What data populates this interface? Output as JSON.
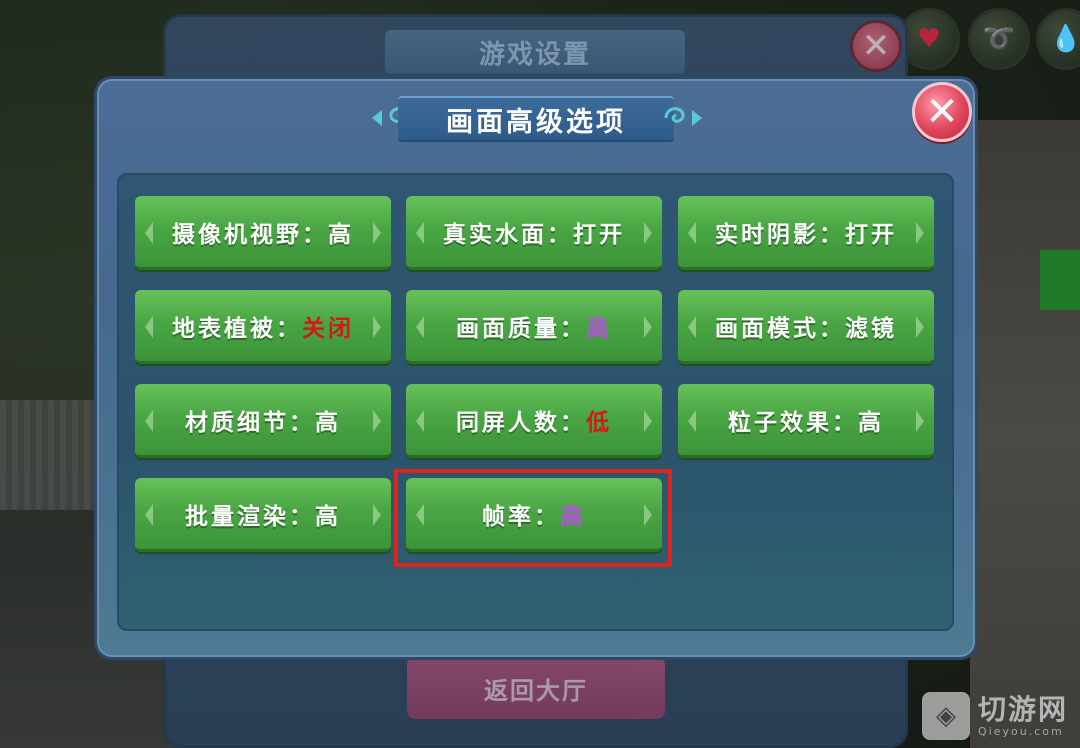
{
  "colors": {
    "accent_green": "#4aa644",
    "panel_blue": "#45688f",
    "value_red": "#d41818",
    "value_purple": "#b055d6",
    "highlight_red": "#e0231f",
    "close_pink": "#e0455c"
  },
  "background_dialog": {
    "title": "游戏设置",
    "return_button_label": "返回大厅"
  },
  "hud": {
    "icons": [
      "heart-icon",
      "arm-icon",
      "water-drop-icon"
    ]
  },
  "dialog": {
    "title": "画面高级选项",
    "options": [
      {
        "label": "摄像机视野：",
        "value": "高",
        "value_color": "white"
      },
      {
        "label": "真实水面：",
        "value": "打开",
        "value_color": "white"
      },
      {
        "label": "实时阴影：",
        "value": "打开",
        "value_color": "white"
      },
      {
        "label": "地表植被：",
        "value": "关闭",
        "value_color": "red"
      },
      {
        "label": "画面质量：",
        "value": "高",
        "value_color": "purple"
      },
      {
        "label": "画面模式：",
        "value": "滤镜",
        "value_color": "white"
      },
      {
        "label": "材质细节：",
        "value": "高",
        "value_color": "white"
      },
      {
        "label": "同屏人数：",
        "value": "低",
        "value_color": "red"
      },
      {
        "label": "粒子效果：",
        "value": "高",
        "value_color": "white"
      },
      {
        "label": "批量渲染：",
        "value": "高",
        "value_color": "white"
      },
      {
        "label": "帧率：",
        "value": "高",
        "value_color": "purple"
      }
    ]
  },
  "watermark": {
    "brand": "切游网",
    "url": "Qieyou.com"
  }
}
